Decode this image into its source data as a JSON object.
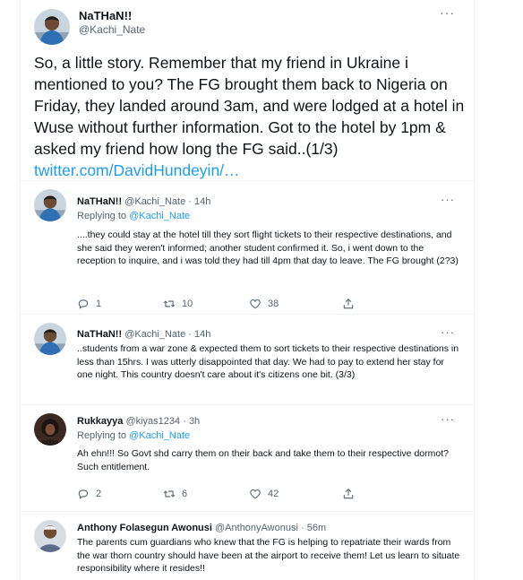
{
  "main_tweet": {
    "name": "NaTHaN!!",
    "handle": "@Kachi_Nate",
    "more": "···",
    "text": "So, a little story. Remember that my friend in Ukraine i mentioned to you? The FG brought them back to Nigeria on Friday, they landed around 3am, and were lodged at a hotel in Wuse without further information. Got to the hotel by 1pm & asked my friend how long the FG said..(1/3) ",
    "link": "twitter.com/DavidHundeyin/…"
  },
  "replies": [
    {
      "name": "NaTHaN!!",
      "handle": "@Kachi_Nate",
      "time": "14h",
      "replying_prefix": "Replying to ",
      "replying_to": "@Kachi_Nate",
      "text": "....they could stay at the hotel till they sort flight tickets to their respective destinations, and she said they weren't informed; another student confirmed it. So, i went down to the reception to inquire, and i was told they had till 4pm that day to leave. The FG brought (2?3)",
      "replies": "1",
      "retweets": "10",
      "likes": "38"
    },
    {
      "name": "NaTHaN!!",
      "handle": "@Kachi_Nate",
      "time": "14h",
      "text": "..students from a war zone & expected them to sort tickets to their respective destinations in less than 15hrs. I was utterly disappointed that day. We had to pay to extend her stay for one night. This country doesn't care about it's citizens one bit. (3/3)"
    },
    {
      "name": "Rukkayya",
      "handle": "@kiyas1234",
      "time": "3h",
      "replying_prefix": "Replying to ",
      "replying_to": "@Kachi_Nate",
      "text": "Ah ehn!!! So Govt shd carry them on their back and take them to their respective dormot? Such entitlement.",
      "replies": "2",
      "retweets": "6",
      "likes": "42"
    },
    {
      "name": "Anthony Folasegun Awonusi",
      "handle": "@AnthonyAwonusi",
      "time": "56m",
      "text": "The parents cum guardians who knew that the FG is helping to repatriate their wards from the war thorn country should have been at the airport to receive them! Let us learn to situate responsibility where it resides!!"
    }
  ],
  "colors": {
    "accent": "#1d9bf0",
    "text": "#0f1419",
    "secondary": "#536471",
    "divider": "#eff3f4"
  },
  "icons": [
    "reply-icon",
    "retweet-icon",
    "like-icon",
    "share-icon",
    "more-icon"
  ]
}
